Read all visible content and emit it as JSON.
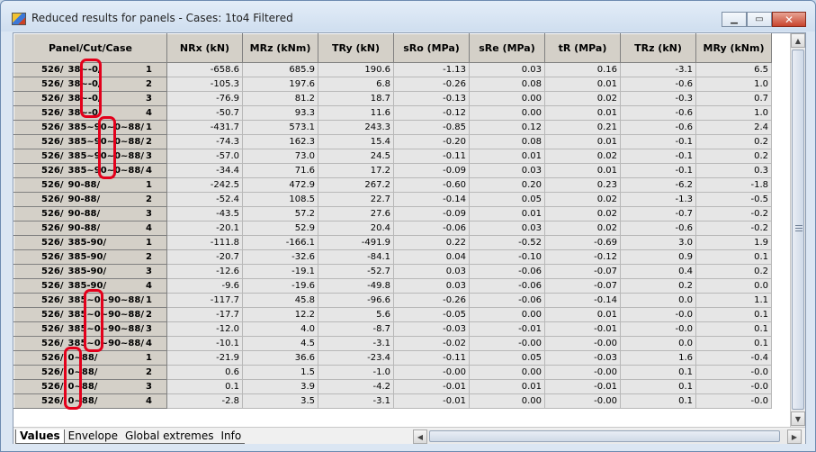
{
  "window": {
    "title": "Reduced results for panels - Cases:  1to4   Filtered",
    "min_icon": "minimize-icon",
    "max_icon": "maximize-icon",
    "close_icon": "close-icon"
  },
  "table": {
    "columns": [
      "Panel/Cut/Case",
      "NRx (kN)",
      "MRz (kNm)",
      "TRy (kN)",
      "sRo (MPa)",
      "sRe (MPa)",
      "tR (MPa)",
      "TRz (kN)",
      "MRy (kNm)"
    ],
    "rows": [
      {
        "panel": "526/",
        "cut": "38~-0/",
        "case": "1",
        "v": [
          "-658.6",
          "685.9",
          "190.6",
          "-1.13",
          "0.03",
          "0.16",
          "-3.1",
          "6.5"
        ]
      },
      {
        "panel": "526/",
        "cut": "38~-0/",
        "case": "2",
        "v": [
          "-105.3",
          "197.6",
          "6.8",
          "-0.26",
          "0.08",
          "0.01",
          "-0.6",
          "1.0"
        ]
      },
      {
        "panel": "526/",
        "cut": "38~-0/",
        "case": "3",
        "v": [
          "-76.9",
          "81.2",
          "18.7",
          "-0.13",
          "0.00",
          "0.02",
          "-0.3",
          "0.7"
        ]
      },
      {
        "panel": "526/",
        "cut": "38~-0/",
        "case": "4",
        "v": [
          "-50.7",
          "93.3",
          "11.6",
          "-0.12",
          "0.00",
          "0.01",
          "-0.6",
          "1.0"
        ]
      },
      {
        "panel": "526/",
        "cut": "385~90~0~88/",
        "case": "1",
        "v": [
          "-431.7",
          "573.1",
          "243.3",
          "-0.85",
          "0.12",
          "0.21",
          "-0.6",
          "2.4"
        ]
      },
      {
        "panel": "526/",
        "cut": "385~90~0~88/",
        "case": "2",
        "v": [
          "-74.3",
          "162.3",
          "15.4",
          "-0.20",
          "0.08",
          "0.01",
          "-0.1",
          "0.2"
        ]
      },
      {
        "panel": "526/",
        "cut": "385~90~0~88/",
        "case": "3",
        "v": [
          "-57.0",
          "73.0",
          "24.5",
          "-0.11",
          "0.01",
          "0.02",
          "-0.1",
          "0.2"
        ]
      },
      {
        "panel": "526/",
        "cut": "385~90~0~88/",
        "case": "4",
        "v": [
          "-34.4",
          "71.6",
          "17.2",
          "-0.09",
          "0.03",
          "0.01",
          "-0.1",
          "0.3"
        ]
      },
      {
        "panel": "526/",
        "cut": "90-88/",
        "case": "1",
        "v": [
          "-242.5",
          "472.9",
          "267.2",
          "-0.60",
          "0.20",
          "0.23",
          "-6.2",
          "-1.8"
        ]
      },
      {
        "panel": "526/",
        "cut": "90-88/",
        "case": "2",
        "v": [
          "-52.4",
          "108.5",
          "22.7",
          "-0.14",
          "0.05",
          "0.02",
          "-1.3",
          "-0.5"
        ]
      },
      {
        "panel": "526/",
        "cut": "90-88/",
        "case": "3",
        "v": [
          "-43.5",
          "57.2",
          "27.6",
          "-0.09",
          "0.01",
          "0.02",
          "-0.7",
          "-0.2"
        ]
      },
      {
        "panel": "526/",
        "cut": "90-88/",
        "case": "4",
        "v": [
          "-20.1",
          "52.9",
          "20.4",
          "-0.06",
          "0.03",
          "0.02",
          "-0.6",
          "-0.2"
        ]
      },
      {
        "panel": "526/",
        "cut": "385-90/",
        "case": "1",
        "v": [
          "-111.8",
          "-166.1",
          "-491.9",
          "0.22",
          "-0.52",
          "-0.69",
          "3.0",
          "1.9"
        ]
      },
      {
        "panel": "526/",
        "cut": "385-90/",
        "case": "2",
        "v": [
          "-20.7",
          "-32.6",
          "-84.1",
          "0.04",
          "-0.10",
          "-0.12",
          "0.9",
          "0.1"
        ]
      },
      {
        "panel": "526/",
        "cut": "385-90/",
        "case": "3",
        "v": [
          "-12.6",
          "-19.1",
          "-52.7",
          "0.03",
          "-0.06",
          "-0.07",
          "0.4",
          "0.2"
        ]
      },
      {
        "panel": "526/",
        "cut": "385-90/",
        "case": "4",
        "v": [
          "-9.6",
          "-19.6",
          "-49.8",
          "0.03",
          "-0.06",
          "-0.07",
          "0.2",
          "0.0"
        ]
      },
      {
        "panel": "526/",
        "cut": "385~0~90~88/",
        "case": "1",
        "v": [
          "-117.7",
          "45.8",
          "-96.6",
          "-0.26",
          "-0.06",
          "-0.14",
          "0.0",
          "1.1"
        ]
      },
      {
        "panel": "526/",
        "cut": "385~0~90~88/",
        "case": "2",
        "v": [
          "-17.7",
          "12.2",
          "5.6",
          "-0.05",
          "0.00",
          "0.01",
          "-0.0",
          "0.1"
        ]
      },
      {
        "panel": "526/",
        "cut": "385~0~90~88/",
        "case": "3",
        "v": [
          "-12.0",
          "4.0",
          "-8.7",
          "-0.03",
          "-0.01",
          "-0.01",
          "-0.0",
          "0.1"
        ]
      },
      {
        "panel": "526/",
        "cut": "385~0~90~88/",
        "case": "4",
        "v": [
          "-10.1",
          "4.5",
          "-3.1",
          "-0.02",
          "-0.00",
          "-0.00",
          "0.0",
          "0.1"
        ]
      },
      {
        "panel": "526/",
        "cut": "0~88/",
        "case": "1",
        "v": [
          "-21.9",
          "36.6",
          "-23.4",
          "-0.11",
          "0.05",
          "-0.03",
          "1.6",
          "-0.4"
        ]
      },
      {
        "panel": "526/",
        "cut": "0~88/",
        "case": "2",
        "v": [
          "0.6",
          "1.5",
          "-1.0",
          "-0.00",
          "0.00",
          "-0.00",
          "0.1",
          "-0.0"
        ]
      },
      {
        "panel": "526/",
        "cut": "0~88/",
        "case": "3",
        "v": [
          "0.1",
          "3.9",
          "-4.2",
          "-0.01",
          "0.01",
          "-0.01",
          "0.1",
          "-0.0"
        ]
      },
      {
        "panel": "526/",
        "cut": "0~88/",
        "case": "4",
        "v": [
          "-2.8",
          "3.5",
          "-3.1",
          "-0.01",
          "0.00",
          "-0.00",
          "0.1",
          "-0.0"
        ]
      }
    ]
  },
  "tabs": [
    "Values",
    "Envelope",
    "Global extremes",
    "Info"
  ],
  "active_tab": "Values",
  "scrollbars": {
    "up_icon": "scroll-up-icon",
    "down_icon": "scroll-down-icon",
    "left_icon": "scroll-left-icon",
    "right_icon": "scroll-right-icon"
  }
}
